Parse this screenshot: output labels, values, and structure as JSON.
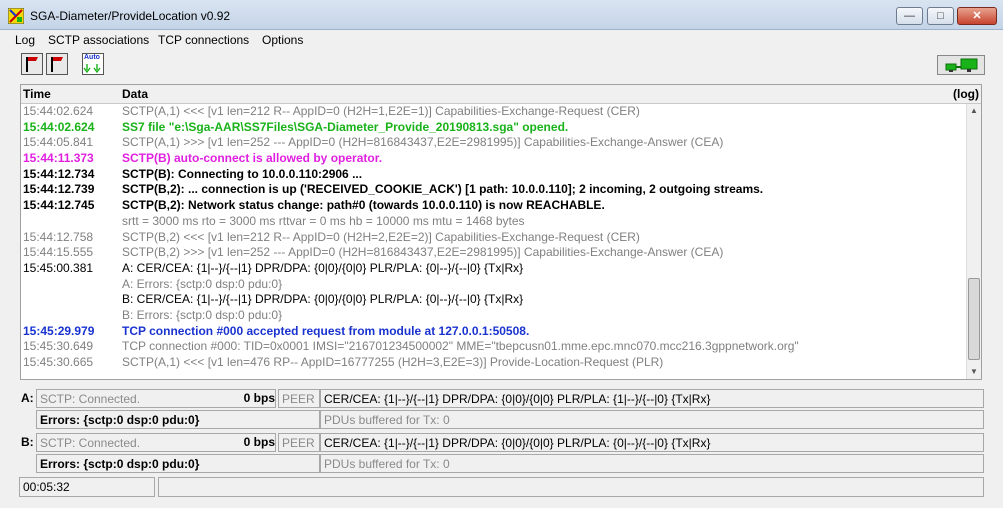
{
  "window": {
    "title": "SGA-Diameter/ProvideLocation  v0.92"
  },
  "menu": [
    "Log",
    "SCTP associations",
    "TCP connections",
    "Options"
  ],
  "toolbar": {
    "buttons": [
      {
        "name": "connect-a-button",
        "icon": "flag-icon"
      },
      {
        "name": "connect-b-button",
        "icon": "flag-icon"
      },
      {
        "name": "auto-button",
        "text": "Auto"
      }
    ]
  },
  "log": {
    "header": {
      "time": "Time",
      "data": "Data",
      "log": "(log)"
    },
    "rows": [
      {
        "time": "15:44:02.624",
        "data": "SCTP(A,1) <<< [v1 len=212 R-- AppID=0 (H2H=1,E2E=1)] Capabilities-Exchange-Request (CER)",
        "color": "gray"
      },
      {
        "time": "15:44:02.624",
        "data": "SS7 file \"e:\\Sga-AAR\\SS7Files\\SGA-Diameter_Provide_20190813.sga\" opened.",
        "color": "green"
      },
      {
        "time": "15:44:05.841",
        "data": "SCTP(A,1) >>> [v1 len=252 --- AppID=0 (H2H=816843437,E2E=2981995)] Capabilities-Exchange-Answer (CEA)",
        "color": "gray"
      },
      {
        "time": "15:44:11.373",
        "data": "SCTP(B) auto-connect is allowed by operator.",
        "color": "magenta"
      },
      {
        "time": "15:44:12.734",
        "data": "SCTP(B): Connecting to 10.0.0.110:2906 ...",
        "color": "black"
      },
      {
        "time": "15:44:12.739",
        "data": "SCTP(B,2): ... connection is up ('RECEIVED_COOKIE_ACK') [1 path: 10.0.0.110]; 2 incoming, 2 outgoing streams.",
        "color": "black"
      },
      {
        "time": "15:44:12.745",
        "data": "SCTP(B,2): Network status change: path#0 (towards 10.0.0.110) is now REACHABLE.",
        "color": "black"
      },
      {
        "time": "",
        "data": "srtt = 3000 ms   rto = 3000 ms   rttvar = 0 ms   hb = 10000 ms   mtu = 1468 bytes",
        "color": "gray"
      },
      {
        "time": "15:44:12.758",
        "data": "SCTP(B,2) <<< [v1 len=212 R-- AppID=0 (H2H=2,E2E=2)] Capabilities-Exchange-Request (CER)",
        "color": "gray"
      },
      {
        "time": "15:44:15.555",
        "data": "SCTP(B,2) >>> [v1 len=252 --- AppID=0 (H2H=816843437,E2E=2981995)] Capabilities-Exchange-Answer (CEA)",
        "color": "gray"
      },
      {
        "time": "15:45:00.381",
        "data": "A:  CER/CEA: {1|--}/{--|1}  DPR/DPA: {0|0}/{0|0}  PLR/PLA: {0|--}/{--|0}  {Tx|Rx}",
        "color": "plain"
      },
      {
        "time": "",
        "data": "A:  Errors: {sctp:0  dsp:0  pdu:0}",
        "color": "gray"
      },
      {
        "time": "",
        "data": "B:  CER/CEA: {1|--}/{--|1}  DPR/DPA: {0|0}/{0|0}  PLR/PLA: {0|--}/{--|0}  {Tx|Rx}",
        "color": "plain"
      },
      {
        "time": "",
        "data": "B:  Errors: {sctp:0  dsp:0  pdu:0}",
        "color": "gray"
      },
      {
        "time": "15:45:29.979",
        "data": "TCP connection #000 accepted request from module at 127.0.0.1:50508.",
        "color": "blue"
      },
      {
        "time": "15:45:30.649",
        "data": "TCP connection #000: TID=0x0001 IMSI=\"216701234500002\" MME=\"tbepcusn01.mme.epc.mnc070.mcc216.3gppnetwork.org\"",
        "color": "gray"
      },
      {
        "time": "15:45:30.665",
        "data": "SCTP(A,1) <<< [v1 len=476 RP-- AppID=16777255 (H2H=3,E2E=3)] Provide-Location-Request (PLR)",
        "color": "gray"
      }
    ]
  },
  "assoc_a": {
    "label": "A:",
    "status": "SCTP:  Connected.",
    "bps": "0 bps",
    "peer": "PEER",
    "counters": "CER/CEA: {1|--}/{--|1}  DPR/DPA: {0|0}/{0|0}  PLR/PLA: {1|--}/{--|0}  {Tx|Rx}",
    "errors": "Errors: {sctp:0  dsp:0  pdu:0}",
    "buffered": "PDUs buffered for Tx: 0"
  },
  "assoc_b": {
    "label": "B:",
    "status": "SCTP:  Connected.",
    "bps": "0 bps",
    "peer": "PEER",
    "counters": "CER/CEA: {1|--}/{--|1}  DPR/DPA: {0|0}/{0|0}  PLR/PLA: {0|--}/{--|0}  {Tx|Rx}",
    "errors": "Errors: {sctp:0  dsp:0  pdu:0}",
    "buffered": "PDUs buffered for Tx: 0"
  },
  "statusbar": {
    "elapsed": "00:05:32",
    "message": ""
  },
  "colors": {
    "gray": "#808080",
    "green": "#19b219",
    "magenta": "#e020e0",
    "blue": "#1a33d0"
  }
}
